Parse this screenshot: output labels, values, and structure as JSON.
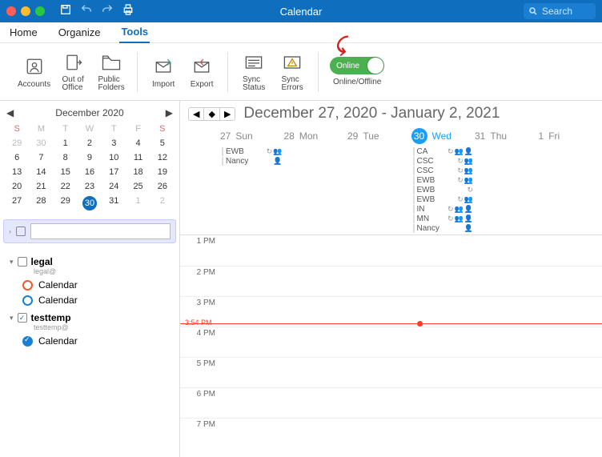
{
  "titlebar": {
    "title": "Calendar",
    "search_placeholder": "Search"
  },
  "tabs": {
    "home": "Home",
    "organize": "Organize",
    "tools": "Tools",
    "active": "tools"
  },
  "ribbon": {
    "accounts": "Accounts",
    "out_of_office": "Out of\nOffice",
    "public_folders": "Public\nFolders",
    "import": "Import",
    "export": "Export",
    "sync_status": "Sync\nStatus",
    "sync_errors": "Sync\nErrors",
    "online_label": "Online",
    "online_offline": "Online/Offline"
  },
  "mini": {
    "title": "December 2020",
    "dow": [
      "S",
      "M",
      "T",
      "W",
      "T",
      "F",
      "S"
    ],
    "cells": [
      {
        "n": "29",
        "o": true
      },
      {
        "n": "30",
        "o": true
      },
      {
        "n": "1"
      },
      {
        "n": "2"
      },
      {
        "n": "3"
      },
      {
        "n": "4"
      },
      {
        "n": "5"
      },
      {
        "n": "6"
      },
      {
        "n": "7"
      },
      {
        "n": "8"
      },
      {
        "n": "9"
      },
      {
        "n": "10"
      },
      {
        "n": "11"
      },
      {
        "n": "12"
      },
      {
        "n": "13"
      },
      {
        "n": "14"
      },
      {
        "n": "15"
      },
      {
        "n": "16"
      },
      {
        "n": "17"
      },
      {
        "n": "18"
      },
      {
        "n": "19"
      },
      {
        "n": "20"
      },
      {
        "n": "21"
      },
      {
        "n": "22"
      },
      {
        "n": "23"
      },
      {
        "n": "24"
      },
      {
        "n": "25"
      },
      {
        "n": "26"
      },
      {
        "n": "27"
      },
      {
        "n": "28"
      },
      {
        "n": "29"
      },
      {
        "n": "30",
        "sel": true
      },
      {
        "n": "31"
      },
      {
        "n": "1",
        "o": true
      },
      {
        "n": "2",
        "o": true
      }
    ]
  },
  "accounts": [
    {
      "name": "legal",
      "email": "legal@",
      "checked": false,
      "cals": [
        {
          "label": "Calendar",
          "style": "orange"
        },
        {
          "label": "Calendar",
          "style": "blue"
        }
      ]
    },
    {
      "name": "testtemp",
      "email": "testtemp@",
      "checked": true,
      "cals": [
        {
          "label": "Calendar",
          "style": "filled"
        }
      ]
    }
  ],
  "main": {
    "range": "December 27, 2020 - January 2, 2021",
    "days": [
      {
        "num": "27",
        "name": "Sun"
      },
      {
        "num": "28",
        "name": "Mon"
      },
      {
        "num": "29",
        "name": "Tue"
      },
      {
        "num": "30",
        "name": "Wed",
        "selected": true
      },
      {
        "num": "31",
        "name": "Thu"
      },
      {
        "num": "1",
        "name": "Fri"
      }
    ],
    "hours": [
      "1 PM",
      "2 PM",
      "3 PM",
      "4 PM",
      "5 PM",
      "6 PM",
      "7 PM"
    ],
    "now_label": "3:54 PM",
    "allday": {
      "27": [
        {
          "title": "EWB",
          "icons": [
            "recur",
            "people"
          ]
        },
        {
          "title": "Nancy",
          "icons": [
            "person"
          ]
        }
      ],
      "30": [
        {
          "title": "CA",
          "icons": [
            "recur",
            "people",
            "person"
          ]
        },
        {
          "title": "CSC",
          "icons": [
            "recur",
            "people"
          ]
        },
        {
          "title": "CSC",
          "icons": [
            "recur",
            "people"
          ]
        },
        {
          "title": "EWB",
          "icons": [
            "recur",
            "people"
          ]
        },
        {
          "title": "EWB",
          "icons": [
            "recur"
          ]
        },
        {
          "title": "EWB",
          "icons": [
            "recur",
            "people"
          ]
        },
        {
          "title": "IN",
          "icons": [
            "recur",
            "people",
            "person"
          ]
        },
        {
          "title": "MN",
          "icons": [
            "recur",
            "people",
            "person"
          ]
        },
        {
          "title": "Nancy",
          "icons": [
            "person"
          ]
        }
      ]
    }
  }
}
